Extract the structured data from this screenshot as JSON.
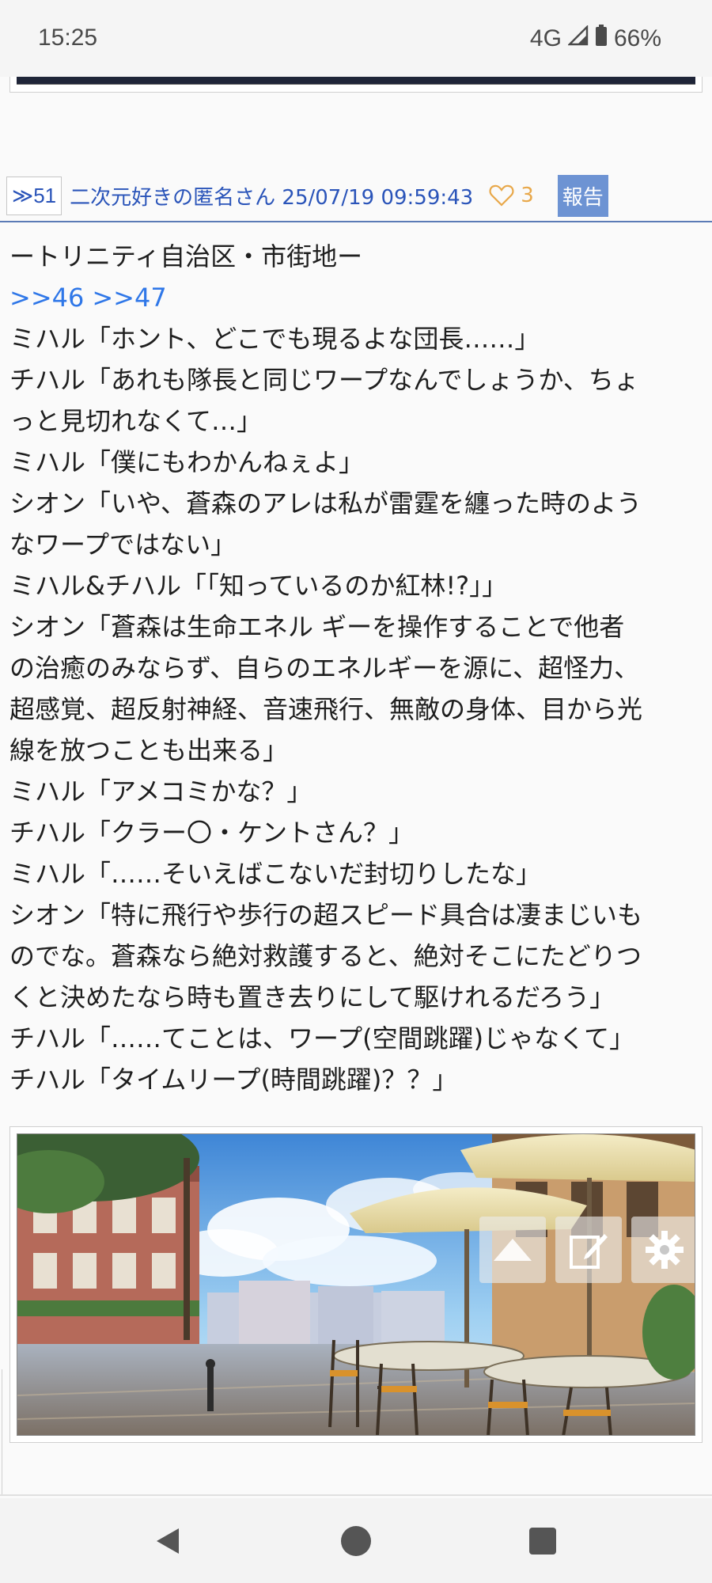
{
  "status_bar": {
    "time": "15:25",
    "network": "4G",
    "battery": "66%",
    "icons": [
      "signal-icon",
      "battery-icon"
    ]
  },
  "post": {
    "res_number": "≫51",
    "poster": "二次元好きの匿名さん 25/07/19 09:59:43",
    "like_count": "3",
    "report_label": "報告",
    "colors": {
      "link": "#2a54b9",
      "anchor": "#2f77e8",
      "like": "#e8a84a",
      "report_bg": "#6d93d3"
    }
  },
  "body": {
    "line1": "ートリニティ自治区・市街地ー",
    "anchors": [
      ">>46",
      ">>47"
    ],
    "lines": [
      "ミハル「ホント、どこでも現るよな団長……」",
      "チハル「あれも隊長と同じワープなんでしょうか、ちょ",
      "っと見切れなくて…」",
      "ミハル「僕にもわかんねぇよ」",
      "シオン「いや、蒼森のアレは私が雷霆を纏った時のよう",
      "なワープではない」",
      "ミハル&チハル「「知っているのか紅林!?」」",
      "シオン「蒼森は生命エネル ギーを操作することで他者",
      "の治癒のみならず、自らのエネルギーを源に、超怪力、",
      "超感覚、超反射神経、音速飛行、無敵の身体、目から光",
      "線を放つことも出来る」",
      "ミハル「アメコミかな？」",
      "チハル「クラー〇・ケントさん？」",
      "ミハル「……そいえばこないだ封切りしたな」",
      "シオン「特に飛行や歩行の超スピード具合は凄まじいも",
      "のでな。蒼森なら絶対救護すると、絶対そこにたどりつ",
      "くと決めたなら時も置き去りにして駆けれるだろう」",
      "チハル「……てことは、ワープ(空間跳躍)じゃなくて」",
      "チハル「タイムリープ(時間跳躍)？？」"
    ]
  },
  "image": {
    "scene": "street-cafe-illustration",
    "buttons": [
      "scroll-top-icon",
      "edit-icon",
      "settings-icon"
    ]
  },
  "nav": {
    "buttons": [
      "back-icon",
      "home-icon",
      "recents-icon"
    ]
  }
}
